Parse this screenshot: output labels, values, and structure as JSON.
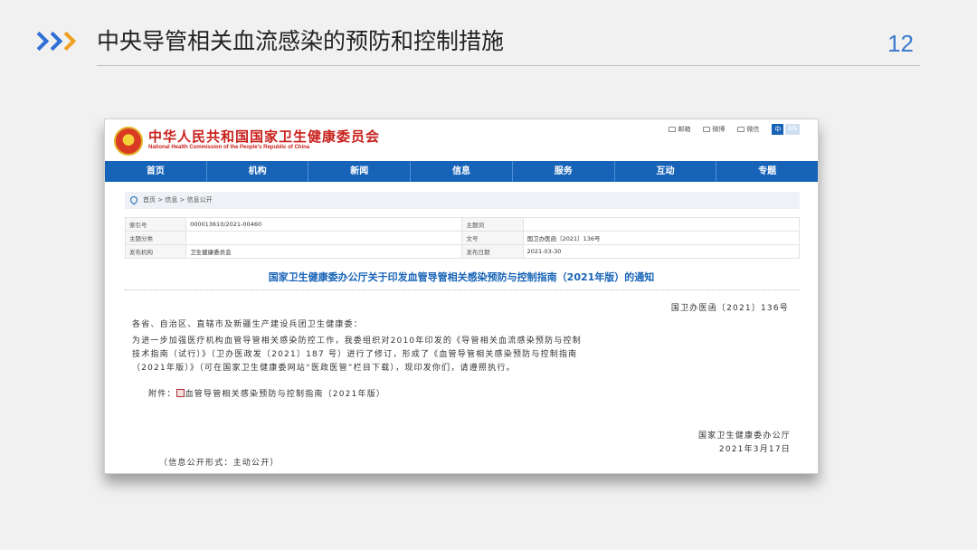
{
  "slide": {
    "title": "中央导管相关血流感染的预防和控制措施",
    "page_number": "12",
    "colors": {
      "accent_blue": "#2f6fd6",
      "accent_orange": "#f0a020",
      "page_number": "#3b7bd0"
    }
  },
  "screenshot": {
    "site_name_cn": "中华人民共和国国家卫生健康委员会",
    "site_name_en": "National Health Commission of the People's Republic of China",
    "tools": [
      "邮箱",
      "微博",
      "微信"
    ],
    "lang": {
      "active": "中",
      "inactive": "EN"
    },
    "nav": [
      "首页",
      "机构",
      "新闻",
      "信息",
      "服务",
      "互动",
      "专题"
    ],
    "breadcrumb": "首页 > 信息 > 信息公开",
    "meta": {
      "index_label": "索引号",
      "index_value": "000013610/2021-00460",
      "theme_label": "主题词",
      "theme_value": "",
      "category_label": "主题分类",
      "category_value": "",
      "docno_label": "文号",
      "docno_value": "国卫办医函〔2021〕136号",
      "issuer_label": "发布机构",
      "issuer_value": "卫生健康委员会",
      "date_label": "发布日期",
      "date_value": "2021-03-30"
    },
    "doc_title": "国家卫生健康委办公厅关于印发血管导管相关感染预防与控制指南（2021年版）的通知",
    "doc_number": "国卫办医函〔2021〕136号",
    "salutation": "各省、自治区、直辖市及新疆生产建设兵团卫生健康委：",
    "paragraph": [
      "    为进一步加强医疗机构血管导管相关感染防控工作，我委组织对2010年印发的《导管相关血流感染预防与控制",
      "技术指南（试行）》（卫办医政发〔2021〕187 号）进行了修订，形成了《血管导管相关感染预防与控制指南",
      "（2021年版）》（可在国家卫生健康委网站“医政医管”栏目下载），现印发你们，请遵照执行。"
    ],
    "attachment_label": "附件：",
    "attachment_name": "血管导管相关感染预防与控制指南（2021年版）",
    "signer": "国家卫生健康委办公厅",
    "sign_date": "2021年3月17日",
    "publicity": "（信息公开形式：主动公开）"
  }
}
